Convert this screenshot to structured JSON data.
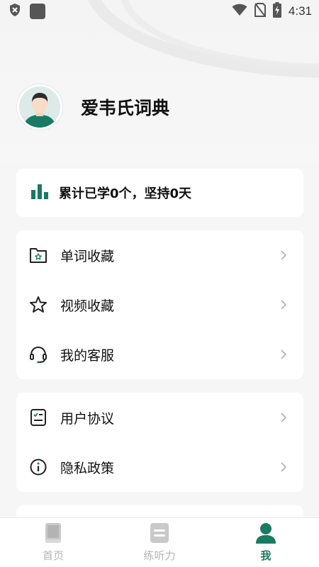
{
  "status_bar": {
    "time": "4:31",
    "icons": [
      "shield-x-icon",
      "app-square-icon",
      "wifi-icon",
      "no-sim-icon",
      "battery-charging-icon"
    ]
  },
  "profile": {
    "username": "爱韦氏词典",
    "avatar_icon": "user-avatar-icon"
  },
  "stats": {
    "text": "累计已学0个，坚持0天",
    "icon": "bar-chart-icon"
  },
  "menu_group_1": [
    {
      "label": "单词收藏",
      "icon": "folder-star-icon"
    },
    {
      "label": "视频收藏",
      "icon": "star-icon"
    },
    {
      "label": "我的客服",
      "icon": "headset-icon"
    }
  ],
  "menu_group_2": [
    {
      "label": "用户协议",
      "icon": "checklist-icon"
    },
    {
      "label": "隐私政策",
      "icon": "info-icon"
    }
  ],
  "tabs": [
    {
      "label": "首页",
      "icon": "book-icon",
      "active": false
    },
    {
      "label": "练听力",
      "icon": "document-icon",
      "active": false
    },
    {
      "label": "我",
      "icon": "person-icon",
      "active": true
    }
  ],
  "colors": {
    "accent": "#1b7a63",
    "inactive": "#b5b5b5",
    "background": "#f6f6f6"
  }
}
